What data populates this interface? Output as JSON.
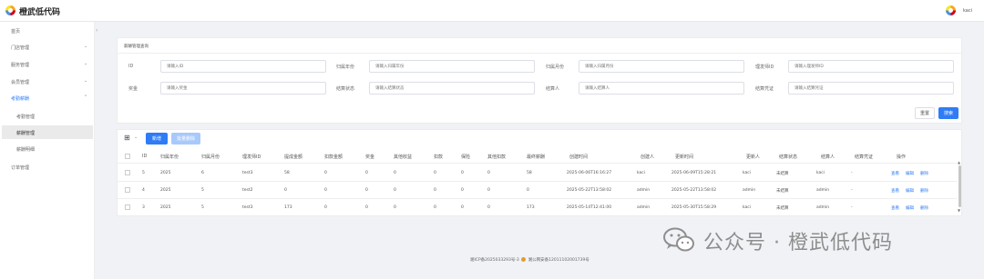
{
  "app": {
    "title": "橙武低代码",
    "user": "kaci"
  },
  "sidebar": {
    "home": "首页",
    "items": [
      {
        "label": "门店管理"
      },
      {
        "label": "服务管理"
      },
      {
        "label": "会员管理"
      },
      {
        "label": "考勤薪酬",
        "active": true,
        "children": [
          "考勤管理",
          "薪酬管理",
          "薪酬明细"
        ]
      },
      {
        "label": "订单管理"
      }
    ]
  },
  "search": {
    "title": "薪酬管理查询",
    "fields": [
      {
        "label": "ID",
        "placeholder": "请输入ID"
      },
      {
        "label": "归属年份",
        "placeholder": "请输入归属年份"
      },
      {
        "label": "归属月份",
        "placeholder": "请输入归属月份"
      },
      {
        "label": "理发师ID",
        "placeholder": "请输入理发师ID"
      },
      {
        "label": "奖金",
        "placeholder": "请输入奖金"
      },
      {
        "label": "结算状态",
        "placeholder": "请输入结算状态"
      },
      {
        "label": "结算人",
        "placeholder": "请输入结算人"
      },
      {
        "label": "结算凭证",
        "placeholder": "请输入结算凭证"
      }
    ],
    "reset": "重置",
    "submit": "搜索"
  },
  "toolbar": {
    "add": "新增",
    "batch_delete": "批量删除"
  },
  "table": {
    "headers": [
      "ID",
      "归属年份",
      "归属月份",
      "理发师ID",
      "提成金额",
      "扣款金额",
      "奖金",
      "其他收益",
      "扣款",
      "保险",
      "其他扣款",
      "最终薪酬",
      "创建时间",
      "创建人",
      "更新时间",
      "更新人",
      "结算状态",
      "结算人",
      "结算凭证",
      "操作"
    ],
    "rows": [
      [
        "5",
        "2025",
        "6",
        "test3",
        "58",
        "0",
        "0",
        "0",
        "0",
        "0",
        "0",
        "58",
        "2025-06-06T16:16:27",
        "kaci",
        "2025-06-09T15:28:21",
        "kaci",
        "未结算",
        "kaci",
        "-"
      ],
      [
        "4",
        "2025",
        "5",
        "test2",
        "0",
        "0",
        "0",
        "0",
        "0",
        "0",
        "0",
        "0",
        "2025-05-22T13:58:02",
        "admin",
        "2025-05-22T13:58:02",
        "admin",
        "未结算",
        "admin",
        "-"
      ],
      [
        "3",
        "2025",
        "5",
        "test3",
        "173",
        "0",
        "0",
        "0",
        "0",
        "0",
        "0",
        "173",
        "2025-05-14T12:41:00",
        "admin",
        "2025-05-30T15:58:29",
        "kaci",
        "未结算",
        "admin",
        "-"
      ]
    ],
    "actions": [
      "查看",
      "编辑",
      "删除"
    ]
  },
  "footer": {
    "icp": "湘ICP备2025033293号-3",
    "police": "湘公网安备12011102001739号"
  },
  "watermark": "公众号 · 橙武低代码"
}
